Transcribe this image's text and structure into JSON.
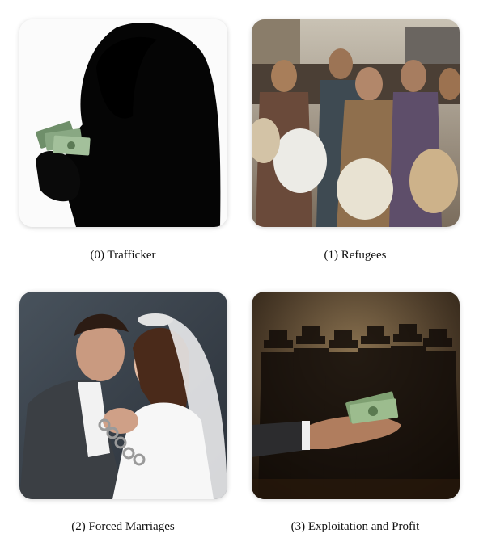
{
  "panels": [
    {
      "caption": "(0) Trafficker",
      "image_subject": "hooded-figure-holding-cash"
    },
    {
      "caption": "(1) Refugees",
      "image_subject": "crowd-of-refugees-with-sacks"
    },
    {
      "caption": "(2) Forced Marriages",
      "image_subject": "chained-bride-and-groom"
    },
    {
      "caption": "(3) Exploitation and Profit",
      "image_subject": "hand-offering-money-shadow-figures"
    }
  ],
  "colors": {
    "background": "#ffffff",
    "caption_text": "#111111"
  }
}
